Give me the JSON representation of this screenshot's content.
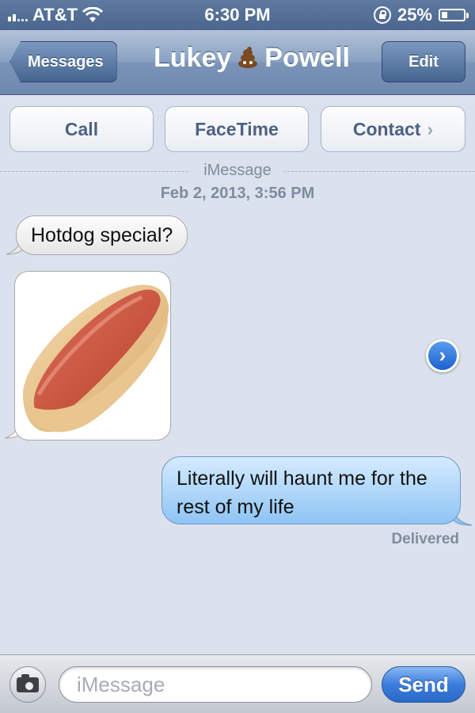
{
  "status_bar": {
    "carrier": "AT&T",
    "time": "6:30 PM",
    "battery_text": "25%",
    "battery_level": 0.25,
    "icons": [
      "signal-icon",
      "wifi-icon",
      "rotation-lock-icon",
      "battery-icon"
    ]
  },
  "nav": {
    "back_label": "Messages",
    "title_first": "Lukey",
    "title_emoji_icon": "pile-of-poo-icon",
    "title_last": "Powell",
    "edit_label": "Edit"
  },
  "actions": {
    "call_label": "Call",
    "facetime_label": "FaceTime",
    "contact_label": "Contact",
    "contact_chevron": "›"
  },
  "thread": {
    "service": "iMessage",
    "date": "Feb 2, 2013, 3:56 PM",
    "messages": [
      {
        "direction": "incoming",
        "type": "text",
        "text": "Hotdog special?"
      },
      {
        "direction": "incoming",
        "type": "image",
        "image_icon": "hotdog-image"
      },
      {
        "direction": "outgoing",
        "type": "text",
        "text": "Literally will haunt me for the rest of my life",
        "status": "Delivered"
      }
    ]
  },
  "compose": {
    "placeholder": "iMessage",
    "send_label": "Send",
    "camera_icon": "camera-icon"
  },
  "colors": {
    "nav_bar": "#7a94b8",
    "background": "#dbe2ed",
    "outgoing_bubble": "#8ec4f4",
    "send_button": "#3b7ddd"
  }
}
